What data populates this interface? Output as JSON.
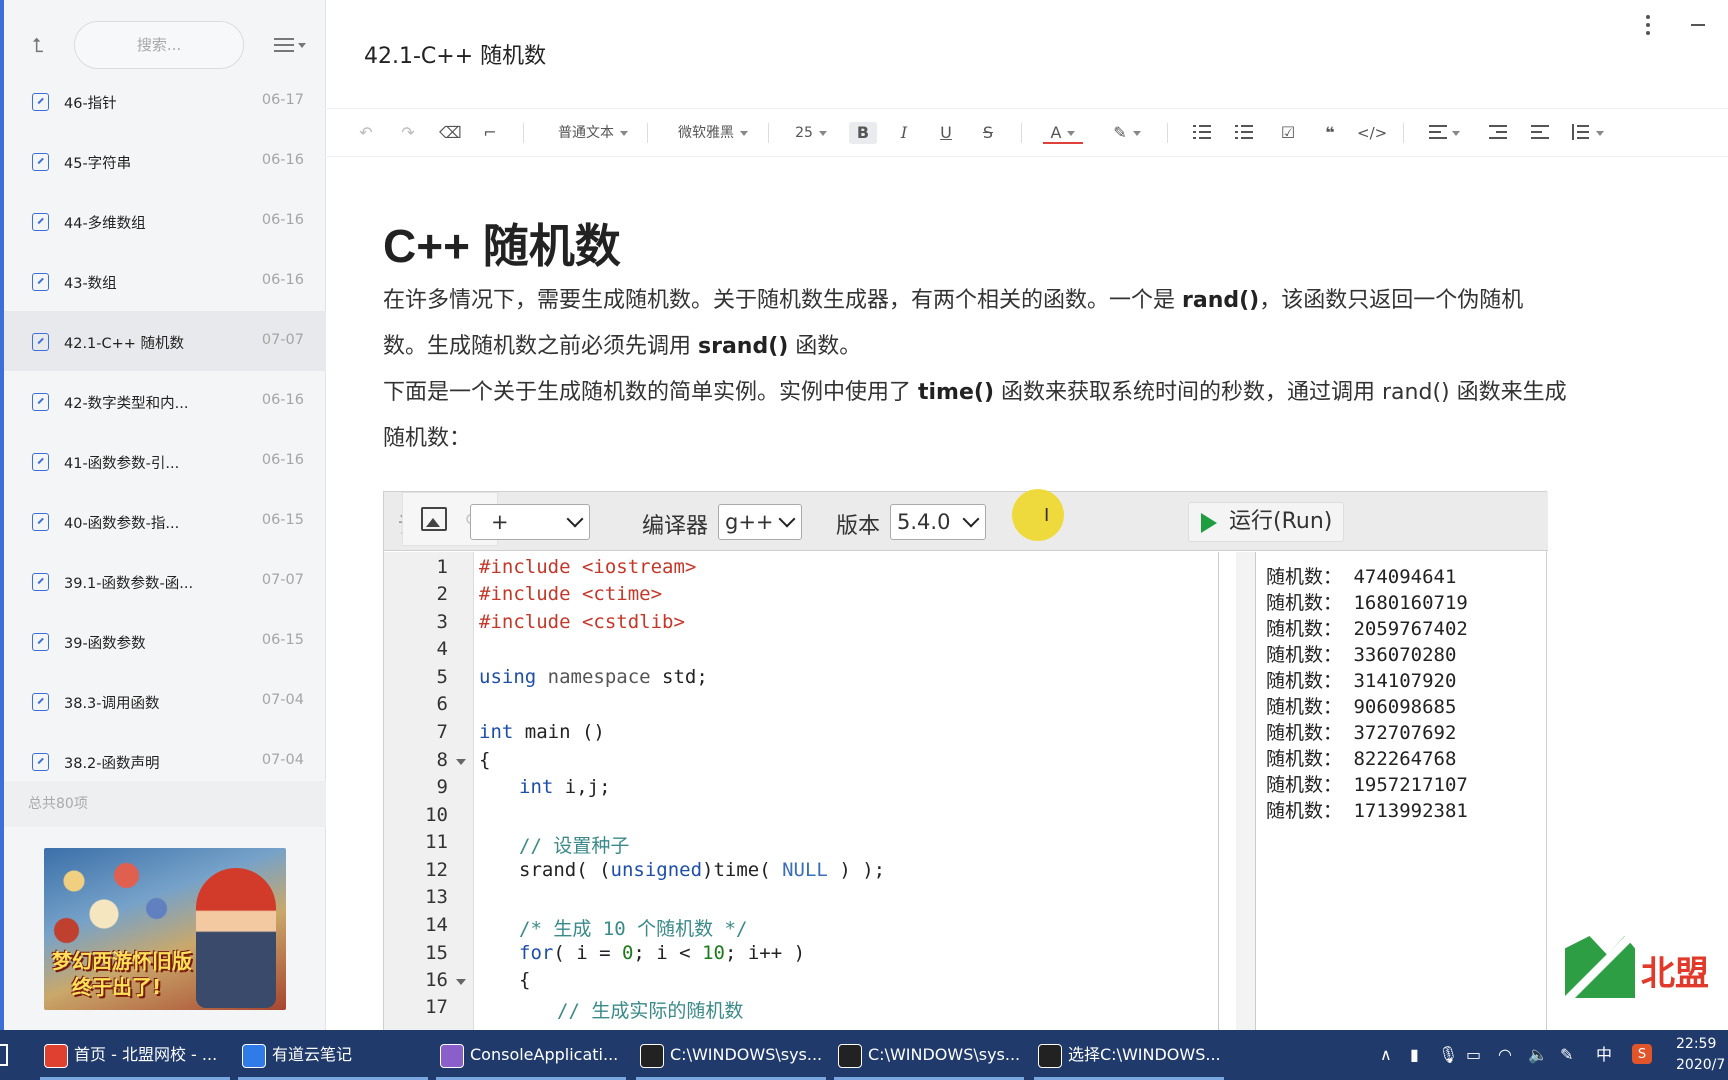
{
  "sidebar": {
    "search_placeholder": "搜索...",
    "notes": [
      {
        "title": "46-指针",
        "date": "06-17"
      },
      {
        "title": "45-字符串",
        "date": "06-16"
      },
      {
        "title": "44-多维数组",
        "date": "06-16"
      },
      {
        "title": "43-数组",
        "date": "06-16"
      },
      {
        "title": "42.1-C++ 随机数",
        "date": "07-07",
        "active": true
      },
      {
        "title": "42-数字类型和内...",
        "date": "06-16"
      },
      {
        "title": "41-函数参数-引...",
        "date": "06-16"
      },
      {
        "title": "40-函数参数-指...",
        "date": "06-15"
      },
      {
        "title": "39.1-函数参数-函...",
        "date": "07-07"
      },
      {
        "title": "39-函数参数",
        "date": "06-15"
      },
      {
        "title": "38.3-调用函数",
        "date": "07-04"
      },
      {
        "title": "38.2-函数声明",
        "date": "07-04"
      }
    ],
    "count_label": "总共80项",
    "ad_text_line1": "梦幻西游怀旧版",
    "ad_text_line2": "终于出了!"
  },
  "header": {
    "doc_title": "42.1-C++ 随机数"
  },
  "toolbar": {
    "style_select": "普通文本",
    "font_select": "微软雅黑",
    "size_select": "25",
    "bold": "B",
    "italic": "I",
    "underline": "U",
    "strike": "S",
    "font_color": "A",
    "quote": "❝",
    "code": "</>"
  },
  "article": {
    "heading": "C++ 随机数",
    "p1_a": "在许多情况下，需要生成随机数。关于随机数生成器，有两个相关的函数。一个是 ",
    "p1_b": "rand()",
    "p1_c": "，该函数只返回一个伪随机",
    "p2_a": "数。生成随机数之前必须先调用 ",
    "p2_b": "srand()",
    "p2_c": " 函数。",
    "p3_a": "下面是一个关于生成随机数的简单实例。实例中使用了 ",
    "p3_b": "time()",
    "p3_c": " 函数来获取系统时间的秒数，通过调用 rand() 函数来生成",
    "p4": "随机数："
  },
  "runner": {
    "lang_label_partial": "语",
    "lang_value_partial": "+",
    "compiler_label": "编译器",
    "compiler_value": "g++",
    "version_label": "版本",
    "version_value": "5.4.0",
    "run_label": "运行(Run)",
    "line_numbers": [
      "1",
      "2",
      "3",
      "4",
      "5",
      "6",
      "7",
      "8",
      "9",
      "10",
      "11",
      "12",
      "13",
      "14",
      "15",
      "16",
      "17"
    ],
    "code": {
      "l1_kw": "#include ",
      "l1_inc": "<iostream>",
      "l2_kw": "#include ",
      "l2_inc": "<ctime>",
      "l3_kw": "#include ",
      "l3_inc": "<cstdlib>",
      "l5_kw": "using ",
      "l5_ns": "namespace ",
      "l5_rest": "std;",
      "l7_kw": "int ",
      "l7_rest": "main ()",
      "l8": "{",
      "l9_kw": "int ",
      "l9_rest": "i,j;",
      "l11": "// 设置种子",
      "l12_a": "srand( (",
      "l12_kw": "unsigned",
      "l12_b": ")time( ",
      "l12_c": "NULL",
      "l12_d": " ) );",
      "l14": "/* 生成 10 个随机数 */",
      "l15_kw": "for",
      "l15_a": "( i = ",
      "l15_n0": "0",
      "l15_b": "; i < ",
      "l15_n10": "10",
      "l15_c": "; i++ )",
      "l16": "{",
      "l17": "// 生成实际的随机数"
    },
    "output": [
      "随机数： 474094641",
      "随机数： 1680160719",
      "随机数： 2059767402",
      "随机数： 336070280",
      "随机数： 314107920",
      "随机数： 906098685",
      "随机数： 372707692",
      "随机数： 822264768",
      "随机数： 1957217107",
      "随机数： 1713992381"
    ]
  },
  "watermark": {
    "text": "北盟"
  },
  "taskbar": {
    "items": [
      {
        "label": "首页 - 北盟网校 - ...",
        "color": "#e04030"
      },
      {
        "label": "有道云笔记",
        "color": "#2f7ce8"
      },
      {
        "label": "ConsoleApplicati...",
        "color": "#8a5fc9"
      },
      {
        "label": "C:\\WINDOWS\\sys...",
        "color": "#222222"
      },
      {
        "label": "C:\\WINDOWS\\sys...",
        "color": "#222222"
      },
      {
        "label": "选择C:\\WINDOWS...",
        "color": "#222222"
      }
    ],
    "ime": "中",
    "clock_time": "22:59",
    "clock_date": "2020/7"
  }
}
